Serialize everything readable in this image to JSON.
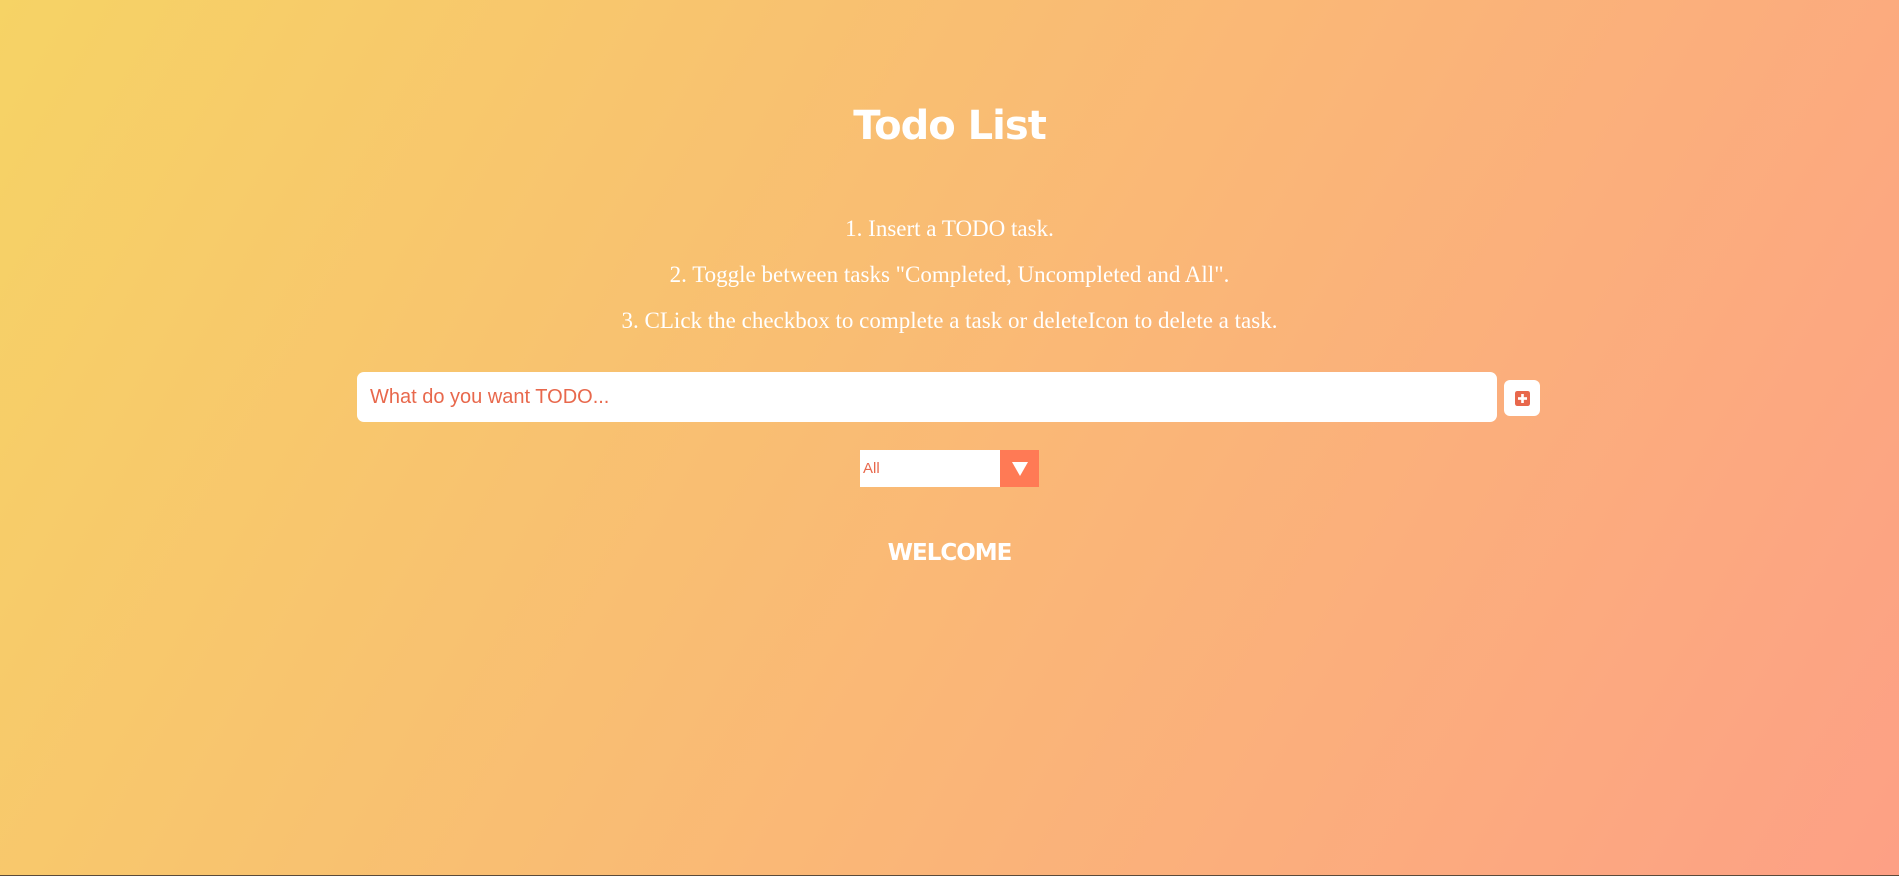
{
  "header": {
    "title": "Todo List"
  },
  "instructions": [
    "1. Insert a TODO task.",
    "2. Toggle between tasks \"Completed, Uncompleted and All\".",
    "3. CLick the checkbox to complete a task or deleteIcon to delete a task."
  ],
  "form": {
    "input_placeholder": "What do you want TODO...",
    "input_value": "",
    "add_button_icon": "plus-square-icon"
  },
  "filter": {
    "selected": "All",
    "arrow_icon": "triangle-down-icon"
  },
  "list": {
    "empty_message": "WELCOME"
  },
  "colors": {
    "gradient_start": "#f6d365",
    "gradient_end": "#fda085",
    "accent": "#ff7a55",
    "placeholder_text": "#e8684c"
  }
}
